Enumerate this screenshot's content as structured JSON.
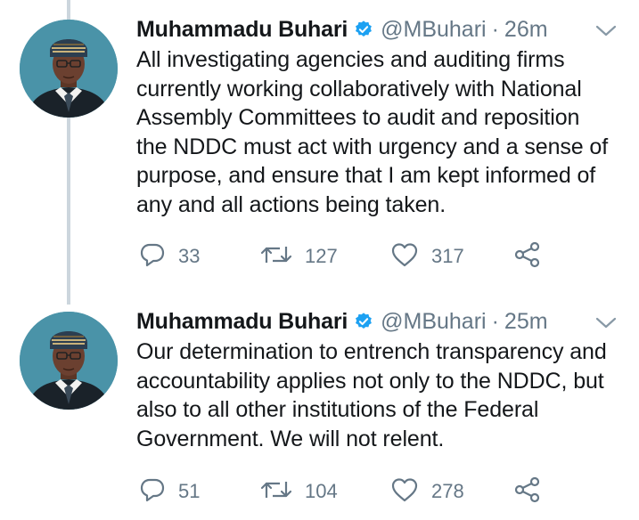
{
  "tweets": [
    {
      "author": "Muhammadu Buhari",
      "handle": "@MBuhari",
      "separator": "·",
      "time": "26m",
      "text_lines": [
        "All investigating agencies and auditing firms",
        "currently working collaboratively with National",
        "Assembly Committees to audit and reposition",
        "the NDDC must act with urgency and a sense of",
        "purpose, and ensure that I am kept informed of",
        "any and all actions being taken."
      ],
      "replies": "33",
      "retweets": "127",
      "likes": "317"
    },
    {
      "author": "Muhammadu Buhari",
      "handle": "@MBuhari",
      "separator": "·",
      "time": "25m",
      "text_lines": [
        "Our determination to entrench transparency and",
        "accountability applies not only to the NDDC, but",
        "also to all other institutions of the Federal",
        "Government. We will not relent."
      ],
      "replies": "51",
      "retweets": "104",
      "likes": "278"
    }
  ],
  "icons": {
    "verified": "verified-badge-icon",
    "caret": "chevron-down-icon",
    "reply": "reply-bubble-icon",
    "retweet": "retweet-icon",
    "like": "heart-icon",
    "share": "share-icon"
  },
  "colors": {
    "text": "#14171a",
    "muted": "#657786",
    "verified": "#1da1f2",
    "thread_line": "#ccd6dd"
  }
}
